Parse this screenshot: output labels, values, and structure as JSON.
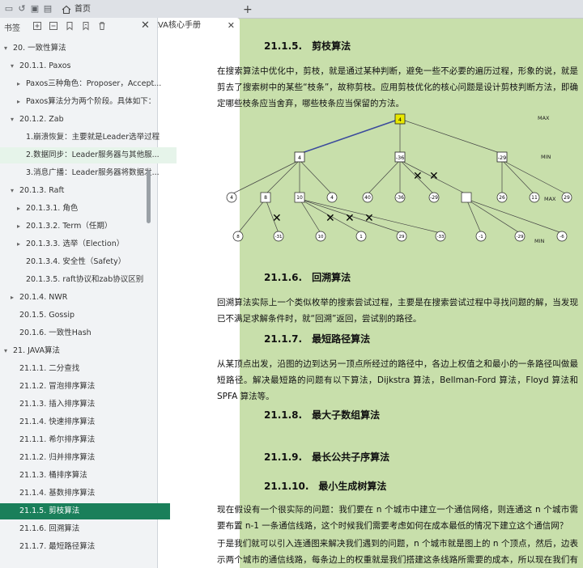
{
  "tabs": {
    "home_label": "首页",
    "doc_label": "JAVA核心手册"
  },
  "sidebar": {
    "title": "书签",
    "items": [
      {
        "label": "20. 一致性算法"
      },
      {
        "label": "20.1.1. Paxos"
      },
      {
        "label": "Paxos三种角色：Proposer，Accept..."
      },
      {
        "label": "Paxos算法分为两个阶段。具体如下："
      },
      {
        "label": "20.1.2. Zab"
      },
      {
        "label": "1.崩溃恢复：主要就是Leader选举过程"
      },
      {
        "label": "2.数据同步：Leader服务器与其他服..."
      },
      {
        "label": "3.消息广播：Leader服务器将数据发..."
      },
      {
        "label": "20.1.3. Raft"
      },
      {
        "label": "20.1.3.1. 角色"
      },
      {
        "label": "20.1.3.2. Term（任期）"
      },
      {
        "label": "20.1.3.3. 选举（Election）"
      },
      {
        "label": "20.1.3.4. 安全性（Safety）"
      },
      {
        "label": "20.1.3.5. raft协议和zab协议区别"
      },
      {
        "label": "20.1.4. NWR"
      },
      {
        "label": "20.1.5. Gossip"
      },
      {
        "label": "20.1.6. 一致性Hash"
      },
      {
        "label": "21. JAVA算法"
      },
      {
        "label": "21.1.1. 二分查找"
      },
      {
        "label": "21.1.2. 冒泡排序算法"
      },
      {
        "label": "21.1.3. 插入排序算法"
      },
      {
        "label": "21.1.4. 快速排序算法"
      },
      {
        "label": "21.1.1. 希尔排序算法"
      },
      {
        "label": "21.1.2. 归并排序算法"
      },
      {
        "label": "21.1.3. 桶排序算法"
      },
      {
        "label": "21.1.4. 基数排序算法"
      },
      {
        "label": "21.1.5. 剪枝算法"
      },
      {
        "label": "21.1.6. 回溯算法"
      },
      {
        "label": "21.1.7. 最短路径算法"
      }
    ]
  },
  "doc": {
    "h_pruning": "21.1.5.　剪枝算法",
    "p_pruning": "在搜索算法中优化中，剪枝，就是通过某种判断，避免一些不必要的遍历过程，形象的说，就是剪去了搜索树中的某些“枝条”，故称剪枝。应用剪枝优化的核心问题是设计剪枝判断方法，即确定哪些枝条应当舍弃，哪些枝条应当保留的方法。",
    "tree": {
      "level_labels": [
        "MAX",
        "MIN",
        "MAX",
        "MIN"
      ],
      "root": "4",
      "l1": [
        "4",
        "-36",
        "-29"
      ],
      "l2": [
        "4",
        "8",
        "10",
        "4",
        "40",
        "-36",
        "-29",
        "",
        "26",
        "11",
        "29"
      ],
      "l3": [
        "8",
        "-31",
        "10",
        "1",
        "29",
        "-33",
        "-1",
        "-29",
        "-6"
      ]
    },
    "h_backtrack": "21.1.6.　回溯算法",
    "p_backtrack": "回溯算法实际上一个类似枚举的搜索尝试过程，主要是在搜索尝试过程中寻找问题的解，当发现已不满足求解条件时，就“回溯”返回，尝试别的路径。",
    "h_shortest": "21.1.7.　最短路径算法",
    "p_shortest": "从某顶点出发，沿图的边到达另一顶点所经过的路径中，各边上权值之和最小的一条路径叫做最短路径。解决最短路的问题有以下算法，Dijkstra 算法，Bellman-Ford 算法，Floyd 算法和 SPFA 算法等。",
    "h_maxsub": "21.1.8.　最大子数组算法",
    "h_lcs": "21.1.9.　最长公共子序算法",
    "h_mst": "21.1.10.　最小生成树算法",
    "p_mst1": "现在假设有一个很实际的问题：我们要在 n 个城市中建立一个通信网络，则连通这 n 个城市需要布置 n-1 一条通信线路，这个时候我们需要考虑如何在成本最低的情况下建立这个通信网？",
    "p_mst2": "于是我们就可以引入连通图来解决我们遇到的问题，n 个城市就是图上的 n 个顶点，然后，边表示两个城市的通信线路，每条边上的权重就是我们搭建这条线路所需要的成本，所以现在我们有 n 个"
  }
}
